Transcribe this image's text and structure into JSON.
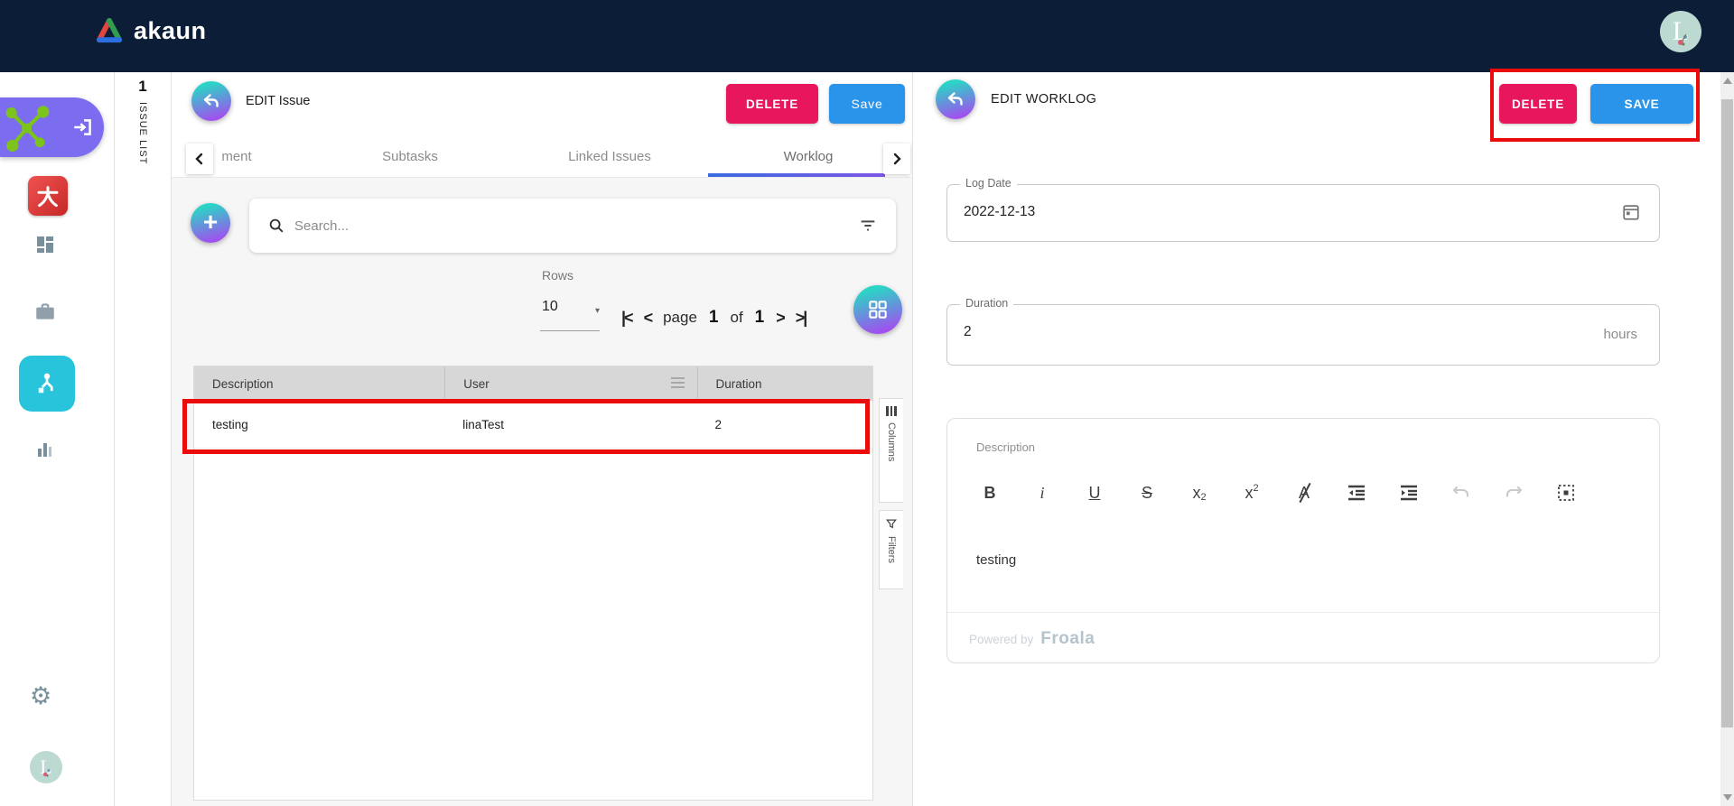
{
  "topbar": {
    "brand": "akaun"
  },
  "issue_strip": {
    "count": "1",
    "label": "ISSUE LIST"
  },
  "left_panel": {
    "title": "EDIT Issue",
    "delete_label": "DELETE",
    "save_label": "Save",
    "tabs": [
      "ment",
      "Subtasks",
      "Linked Issues",
      "Worklog"
    ],
    "search_placeholder": "Search...",
    "rows_label": "Rows",
    "rows_value": "10",
    "pagination": {
      "first": "|<",
      "prev": "<",
      "page_word": "page",
      "current": "1",
      "of_word": "of",
      "total": "1",
      "next": ">",
      "last": ">|"
    },
    "table": {
      "columns": [
        "Description",
        "User",
        "Duration"
      ],
      "rows": [
        {
          "description": "testing",
          "user": "linaTest",
          "duration": "2"
        }
      ]
    },
    "side_tabs": {
      "columns": "Columns",
      "filters": "Filters"
    }
  },
  "right_panel": {
    "title": "EDIT WORKLOG",
    "delete_label": "DELETE",
    "save_label": "SAVE",
    "log_date": {
      "label": "Log Date",
      "value": "2022-12-13"
    },
    "duration": {
      "label": "Duration",
      "value": "2",
      "suffix": "hours"
    },
    "editor": {
      "label": "Description",
      "toolbar": {
        "bold": "B",
        "italic": "i",
        "underline": "U",
        "strikethrough": "S",
        "sub_base": "x",
        "sub_small": "2",
        "sup_base": "x",
        "sup_small": "2",
        "clear": "A"
      },
      "content": "testing",
      "footer_prefix": "Powered by",
      "footer_brand": "Froala"
    }
  },
  "colors": {
    "accent_pink": "#e8175d",
    "accent_blue": "#2a94ea",
    "annotation_red": "#ea0b0b",
    "active_tile": "#27c4dc",
    "gradient_teal": "#2bd4c6",
    "gradient_purple": "#a44cf0"
  }
}
